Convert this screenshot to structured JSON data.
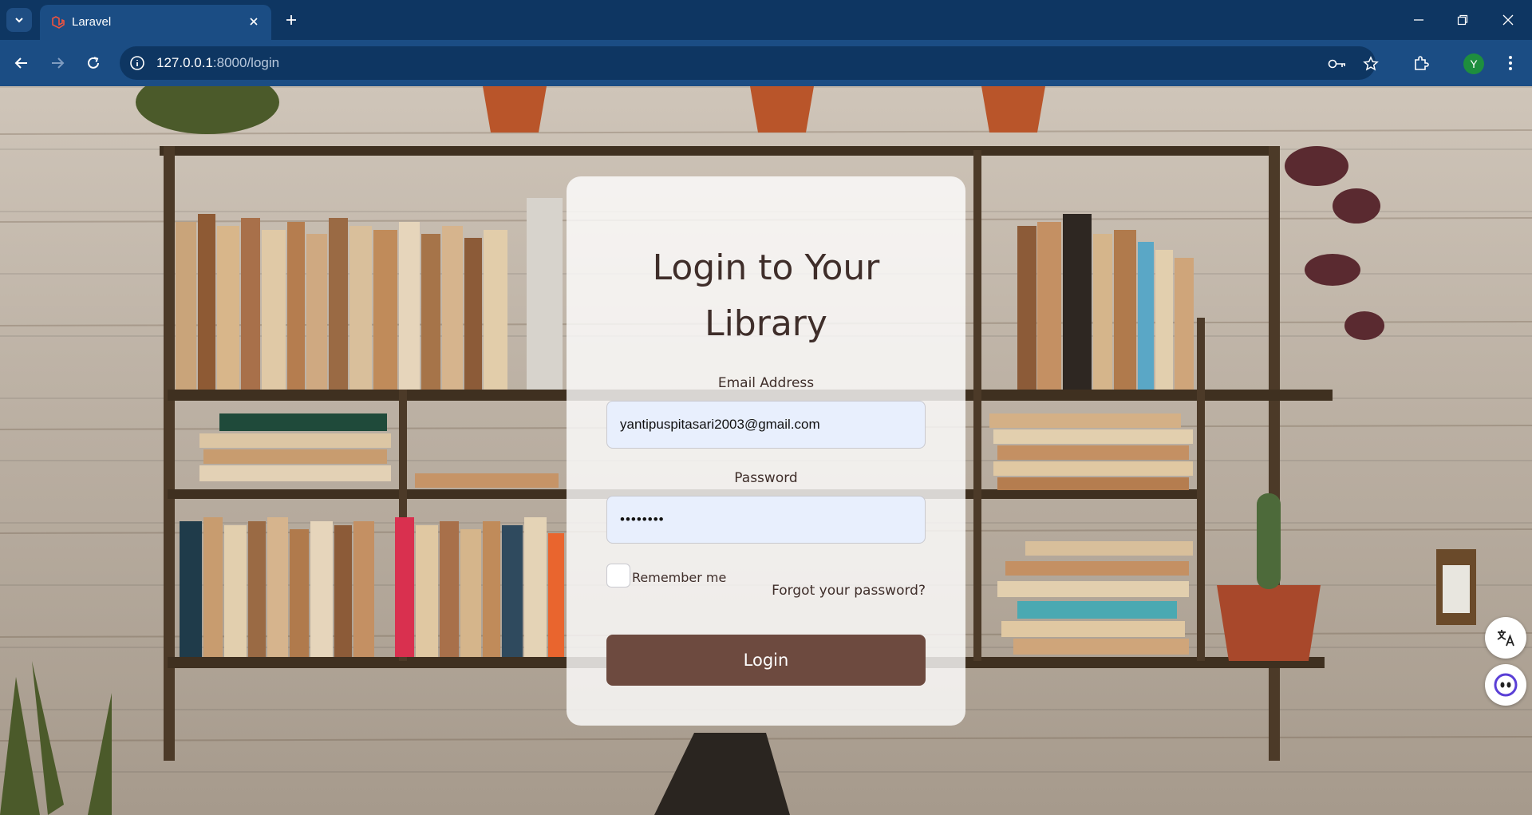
{
  "browser": {
    "tab_title": "Laravel",
    "url_host": "127.0.0.1",
    "url_path": ":8000/login",
    "profile_initial": "Y"
  },
  "login": {
    "title_line1": "Login to Your",
    "title_line2": "Library",
    "email_label": "Email Address",
    "email_value": "yantipuspitasari2003@gmail.com",
    "password_label": "Password",
    "password_value": "••••••••",
    "remember_label": "Remember me",
    "forgot_label": "Forgot your password?",
    "login_button": "Login"
  },
  "colors": {
    "chrome_dark": "#0e3662",
    "chrome_toolbar": "#1b4d84",
    "button_brown": "#6d4a3f",
    "text_brown": "#3f2e2a",
    "input_bg": "#e8effd"
  },
  "icons": [
    "tab-search-icon",
    "laravel-icon",
    "close-icon",
    "plus-icon",
    "minimize-icon",
    "restore-icon",
    "back-icon",
    "forward-icon",
    "reload-icon",
    "info-icon",
    "key-icon",
    "star-icon",
    "extensions-icon",
    "more-icon",
    "translate-icon",
    "assistant-icon"
  ]
}
